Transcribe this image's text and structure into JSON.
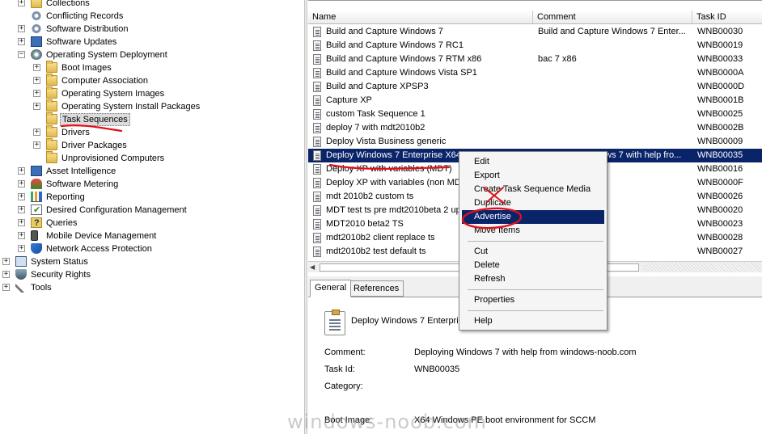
{
  "tree": {
    "items": [
      {
        "label": "Collections",
        "expander": "+",
        "icon": "folder-icon"
      },
      {
        "label": "Conflicting Records",
        "expander": "",
        "icon": "gear-icon"
      },
      {
        "label": "Software Distribution",
        "expander": "+",
        "icon": "gear-icon"
      },
      {
        "label": "Software Updates",
        "expander": "+",
        "icon": "book-icon"
      },
      {
        "label": "Operating System Deployment",
        "expander": "−",
        "icon": "disc-icon"
      },
      {
        "label": "Boot Images",
        "expander": "+",
        "icon": "folder-icon"
      },
      {
        "label": "Computer Association",
        "expander": "+",
        "icon": "folder-icon"
      },
      {
        "label": "Operating System Images",
        "expander": "+",
        "icon": "folder-icon"
      },
      {
        "label": "Operating System Install Packages",
        "expander": "+",
        "icon": "folder-icon"
      },
      {
        "label": "Task Sequences",
        "expander": "",
        "icon": "folder-icon",
        "selected": true
      },
      {
        "label": "Drivers",
        "expander": "+",
        "icon": "folder-icon"
      },
      {
        "label": "Driver Packages",
        "expander": "+",
        "icon": "folder-icon"
      },
      {
        "label": "Unprovisioned Computers",
        "expander": "",
        "icon": "folder-icon"
      },
      {
        "label": "Asset Intelligence",
        "expander": "+",
        "icon": "book-icon"
      },
      {
        "label": "Software Metering",
        "expander": "+",
        "icon": "meter-icon"
      },
      {
        "label": "Reporting",
        "expander": "+",
        "icon": "chart-icon"
      },
      {
        "label": "Desired Configuration Management",
        "expander": "+",
        "icon": "checklist-icon"
      },
      {
        "label": "Queries",
        "expander": "+",
        "icon": "query-icon"
      },
      {
        "label": "Mobile Device Management",
        "expander": "+",
        "icon": "phone-icon"
      },
      {
        "label": "Network Access Protection",
        "expander": "+",
        "icon": "shield-icon"
      },
      {
        "label": "System Status",
        "expander": "+",
        "icon": "monitor-icon"
      },
      {
        "label": "Security Rights",
        "expander": "+",
        "icon": "security-icon"
      },
      {
        "label": "Tools",
        "expander": "+",
        "icon": "tools-icon"
      }
    ]
  },
  "list": {
    "columns": [
      "Name",
      "Comment",
      "Task ID"
    ],
    "rows": [
      {
        "name": "Build and Capture Windows 7",
        "comment": "Build and Capture Windows 7 Enter...",
        "id": "WNB00030"
      },
      {
        "name": "Build and Capture Windows 7 RC1",
        "comment": "",
        "id": "WNB00019"
      },
      {
        "name": "Build and Capture Windows 7 RTM x86",
        "comment": "bac 7 x86",
        "id": "WNB00033"
      },
      {
        "name": "Build and Capture Windows Vista SP1",
        "comment": "",
        "id": "WNB0000A"
      },
      {
        "name": "Build and Capture XPSP3",
        "comment": "",
        "id": "WNB0000D"
      },
      {
        "name": "Capture XP",
        "comment": "",
        "id": "WNB0001B"
      },
      {
        "name": "custom Task Sequence 1",
        "comment": "",
        "id": "WNB00025"
      },
      {
        "name": "deploy 7 with mdt2010b2",
        "comment": "",
        "id": "WNB0002B"
      },
      {
        "name": "Deploy Vista Business generic",
        "comment": "",
        "id": "WNB00009"
      },
      {
        "name": "Deploy Windows 7 Enterprise X64 RTM",
        "comment": "Deploying Windows 7 with help fro...",
        "id": "WNB00035",
        "selected": true
      },
      {
        "name": "Deploy XP with variables (MDT)",
        "comment": "",
        "id": "WNB00016"
      },
      {
        "name": "Deploy XP with variables (non MDT)",
        "comment": "",
        "id": "WNB0000F"
      },
      {
        "name": "mdt 2010b2 custom ts",
        "comment": "",
        "id": "WNB00026"
      },
      {
        "name": "MDT test ts pre mdt2010beta 2 upgrade",
        "comment": "",
        "id": "WNB00020"
      },
      {
        "name": "MDT2010 beta2 TS",
        "comment": "",
        "id": "WNB00023"
      },
      {
        "name": "mdt2010b2 client replace ts",
        "comment": "",
        "id": "WNB00028"
      },
      {
        "name": "mdt2010b2 test default ts",
        "comment": "",
        "id": "WNB00027"
      }
    ]
  },
  "details": {
    "tabs": [
      "General",
      "References"
    ],
    "title": "Deploy Windows 7 Enterpris",
    "fields": [
      {
        "label": "Comment:",
        "value": "Deploying Windows 7 with help from windows-noob.com"
      },
      {
        "label": "Task Id:",
        "value": "WNB00035"
      },
      {
        "label": "Category:",
        "value": ""
      },
      {
        "label": "Boot Image:",
        "value": "X64 Windows PE boot environment for SCCM"
      }
    ]
  },
  "context_menu": {
    "items": [
      "Edit",
      "Export",
      "Create Task Sequence Media",
      "Duplicate",
      "Advertise",
      "Move Items",
      "Cut",
      "Delete",
      "Refresh",
      "Properties",
      "Help"
    ],
    "highlighted": "Advertise"
  },
  "watermark": "windows-noob.com",
  "colors": {
    "selection": "#0a246a",
    "annotation": "#e0101a"
  }
}
